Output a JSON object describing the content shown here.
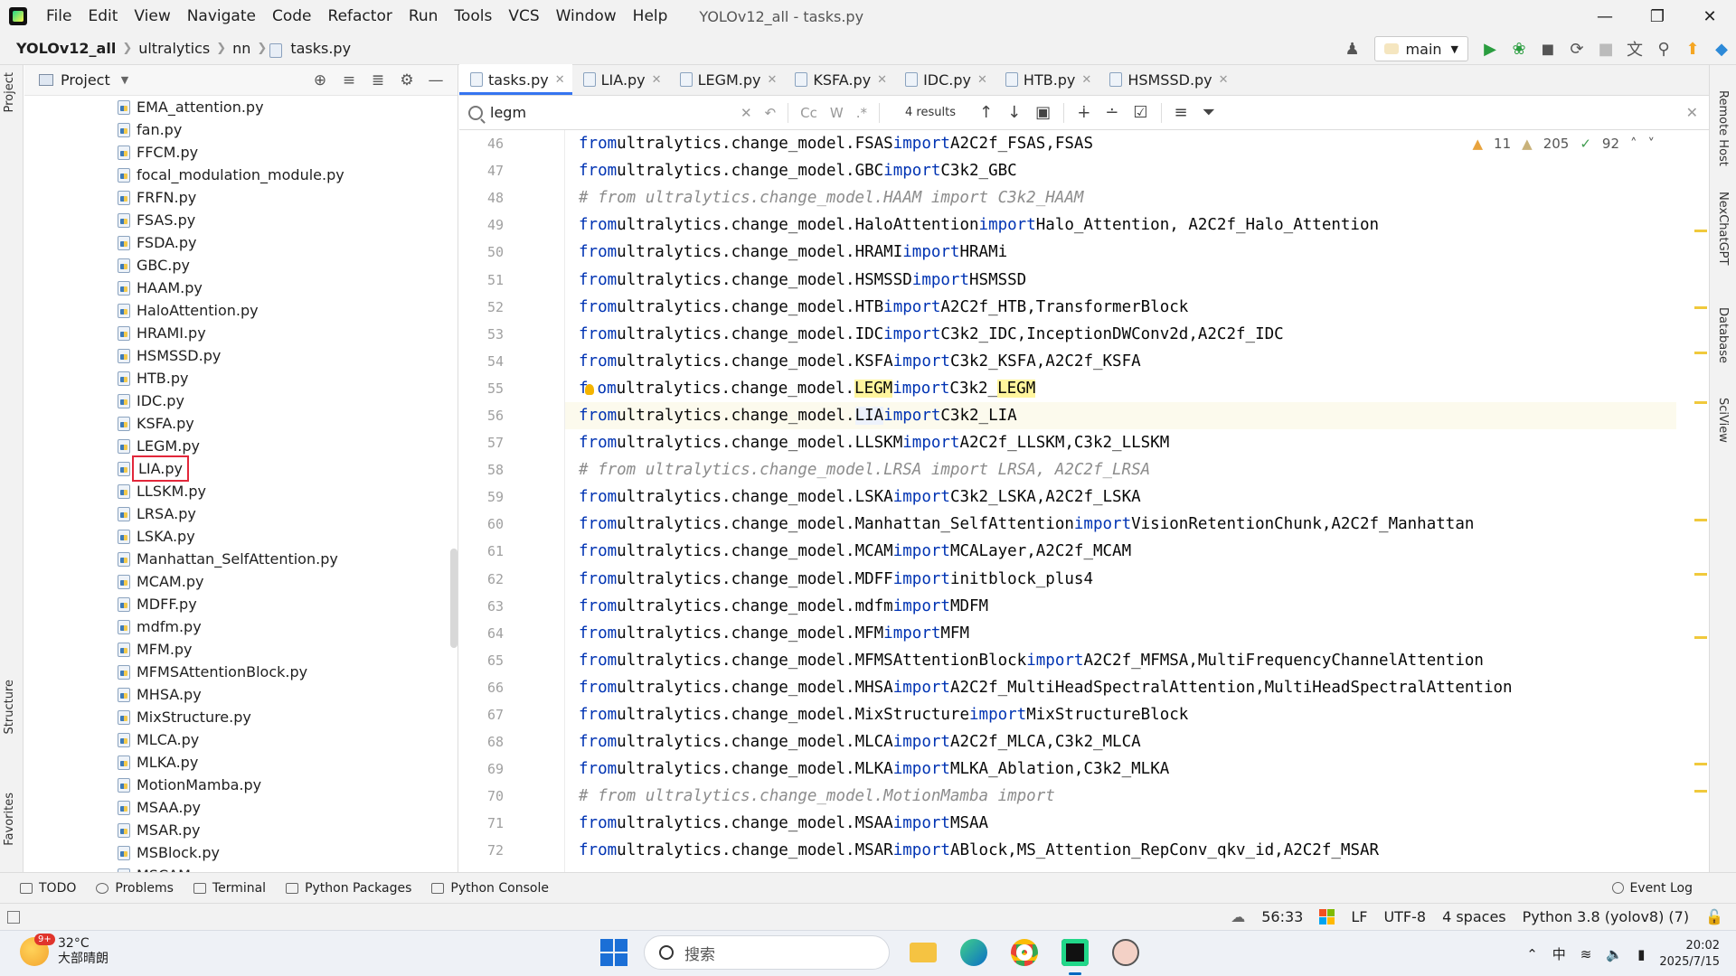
{
  "menubar": {
    "menus": [
      "File",
      "Edit",
      "View",
      "Navigate",
      "Code",
      "Refactor",
      "Run",
      "Tools",
      "VCS",
      "Window",
      "Help"
    ],
    "window_title": "YOLOv12_all - tasks.py"
  },
  "navbar": {
    "crumbs": [
      "YOLOv12_all",
      "ultralytics",
      "nn",
      "tasks.py"
    ],
    "branch": "main"
  },
  "left_strip": {
    "project": "Project",
    "structure": "Structure",
    "favorites": "Favorites"
  },
  "right_strip": {
    "remote_host": "Remote Host",
    "nexchatgpt": "NexChatGPT",
    "database": "Database",
    "sciview": "SciView"
  },
  "project": {
    "title": "Project",
    "files": [
      "EMA_attention.py",
      "fan.py",
      "FFCM.py",
      "focal_modulation_module.py",
      "FRFN.py",
      "FSAS.py",
      "FSDA.py",
      "GBC.py",
      "HAAM.py",
      "HaloAttention.py",
      "HRAMI.py",
      "HSMSSD.py",
      "HTB.py",
      "IDC.py",
      "KSFA.py",
      "LEGM.py",
      "LIA.py",
      "LLSKM.py",
      "LRSA.py",
      "LSKA.py",
      "Manhattan_SelfAttention.py",
      "MCAM.py",
      "MDFF.py",
      "mdfm.py",
      "MFM.py",
      "MFMSAttentionBlock.py",
      "MHSA.py",
      "MixStructure.py",
      "MLCA.py",
      "MLKA.py",
      "MotionMamba.py",
      "MSAA.py",
      "MSAR.py",
      "MSBlock.py",
      "MSCAM"
    ],
    "highlighted_file": "LIA.py"
  },
  "editor": {
    "tabs": [
      "tasks.py",
      "LIA.py",
      "LEGM.py",
      "KSFA.py",
      "IDC.py",
      "HTB.py",
      "HSMSSD.py"
    ],
    "active_tab": "tasks.py",
    "find": {
      "query": "legm",
      "results": "4 results"
    },
    "inspections": {
      "warnings": "11",
      "weak_warnings": "205",
      "typos": "92"
    },
    "lines": [
      {
        "n": "46",
        "t": "code",
        "mod": "FSAS",
        "imp": "A2C2f_FSAS,FSAS"
      },
      {
        "n": "47",
        "t": "code",
        "mod": "GBC",
        "imp": "C3k2_GBC"
      },
      {
        "n": "48",
        "t": "comment",
        "text": "# from ultralytics.change_model.HAAM import C3k2_HAAM"
      },
      {
        "n": "49",
        "t": "code",
        "mod": "HaloAttention",
        "imp": "Halo_Attention, A2C2f_Halo_Attention"
      },
      {
        "n": "50",
        "t": "code",
        "mod": "HRAMI",
        "imp": "HRAMi"
      },
      {
        "n": "51",
        "t": "code",
        "mod": "HSMSSD",
        "imp": "HSMSSD"
      },
      {
        "n": "52",
        "t": "code",
        "mod": "HTB",
        "imp": "A2C2f_HTB,TransformerBlock"
      },
      {
        "n": "53",
        "t": "code",
        "mod": "IDC",
        "imp": "C3k2_IDC,InceptionDWConv2d,A2C2f_IDC"
      },
      {
        "n": "54",
        "t": "code",
        "mod": "KSFA",
        "imp": "C3k2_KSFA,A2C2f_KSFA"
      },
      {
        "n": "55",
        "t": "legm",
        "mod": "LEGM",
        "imp_pre": "C3k2_",
        "imp_hl": "LEGM"
      },
      {
        "n": "56",
        "t": "current",
        "mod": "LIA",
        "imp": "C3k2_LIA"
      },
      {
        "n": "57",
        "t": "code",
        "mod": "LLSKM",
        "imp": "A2C2f_LLSKM,C3k2_LLSKM"
      },
      {
        "n": "58",
        "t": "comment",
        "text": "# from ultralytics.change_model.LRSA import LRSA, A2C2f_LRSA"
      },
      {
        "n": "59",
        "t": "code",
        "mod": "LSKA",
        "imp": "C3k2_LSKA,A2C2f_LSKA"
      },
      {
        "n": "60",
        "t": "code",
        "mod": "Manhattan_SelfAttention",
        "imp": "VisionRetentionChunk,A2C2f_Manhattan"
      },
      {
        "n": "61",
        "t": "code",
        "mod": "MCAM",
        "imp": "MCALayer,A2C2f_MCAM"
      },
      {
        "n": "62",
        "t": "code",
        "mod": "MDFF",
        "imp": "initblock_plus4"
      },
      {
        "n": "63",
        "t": "code",
        "mod": "mdfm",
        "imp": "MDFM"
      },
      {
        "n": "64",
        "t": "code",
        "mod": "MFM",
        "imp": "MFM"
      },
      {
        "n": "65",
        "t": "code",
        "mod": "MFMSAttentionBlock",
        "imp": "A2C2f_MFMSA,MultiFrequencyChannelAttention"
      },
      {
        "n": "66",
        "t": "code",
        "mod": "MHSA",
        "imp": "A2C2f_MultiHeadSpectralAttention,MultiHeadSpectralAttention"
      },
      {
        "n": "67",
        "t": "code",
        "mod": "MixStructure",
        "imp": "MixStructureBlock"
      },
      {
        "n": "68",
        "t": "code",
        "mod": "MLCA",
        "imp": "A2C2f_MLCA,C3k2_MLCA"
      },
      {
        "n": "69",
        "t": "code",
        "mod": "MLKA",
        "imp": "MLKA_Ablation,C3k2_MLKA"
      },
      {
        "n": "70",
        "t": "comment",
        "text": "# from ultralytics.change_model.MotionMamba import"
      },
      {
        "n": "71",
        "t": "code",
        "mod": "MSAA",
        "imp": "MSAA"
      },
      {
        "n": "72",
        "t": "code",
        "mod": "MSAR",
        "imp": "ABlock,MS_Attention_RepConv_qkv_id,A2C2f_MSAR"
      }
    ],
    "keywords": {
      "from": "from",
      "import": "import",
      "pkg": "ultralytics.change_model."
    }
  },
  "bottombar": {
    "tools": [
      "TODO",
      "Problems",
      "Terminal",
      "Python Packages",
      "Python Console"
    ],
    "event_log": "Event Log"
  },
  "statusbar": {
    "position": "56:33",
    "line_sep": "LF",
    "encoding": "UTF-8",
    "indent": "4 spaces",
    "interpreter": "Python 3.8 (yolov8) (7)"
  },
  "taskbar": {
    "weather_temp": "32°C",
    "weather_desc": "大部晴朗",
    "weather_badge": "9+",
    "search_placeholder": "搜索",
    "ime": "中",
    "time": "20:02",
    "date": "2025/7/15"
  },
  "colors": {
    "accent": "#3574f0",
    "keyword": "#0033b3",
    "comment": "#8c8c8c",
    "find_highlight": "#fff59d",
    "selection_box": "#e2273a"
  }
}
